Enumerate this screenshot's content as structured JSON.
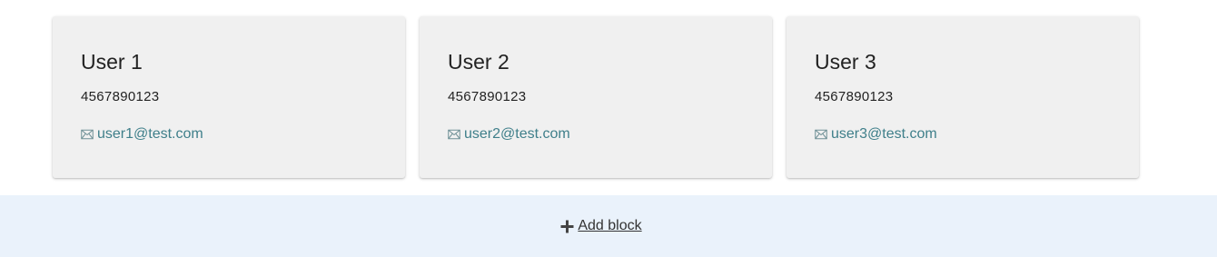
{
  "users": [
    {
      "name": "User 1",
      "phone": "4567890123",
      "email": "user1@test.com",
      "email_icon": "mail-icon"
    },
    {
      "name": "User 2",
      "phone": "4567890123",
      "email": "user2@test.com",
      "email_icon": "mail-icon"
    },
    {
      "name": "User 3",
      "phone": "4567890123",
      "email": "user3@test.com",
      "email_icon": "mail-icon"
    }
  ],
  "add_block": {
    "label": "Add block",
    "icon": "plus-icon"
  },
  "colors": {
    "card_background": "#f0f0f0",
    "email_link": "#3f7f8a",
    "add_block_bar": "#eaf2fb",
    "text": "#222222"
  }
}
